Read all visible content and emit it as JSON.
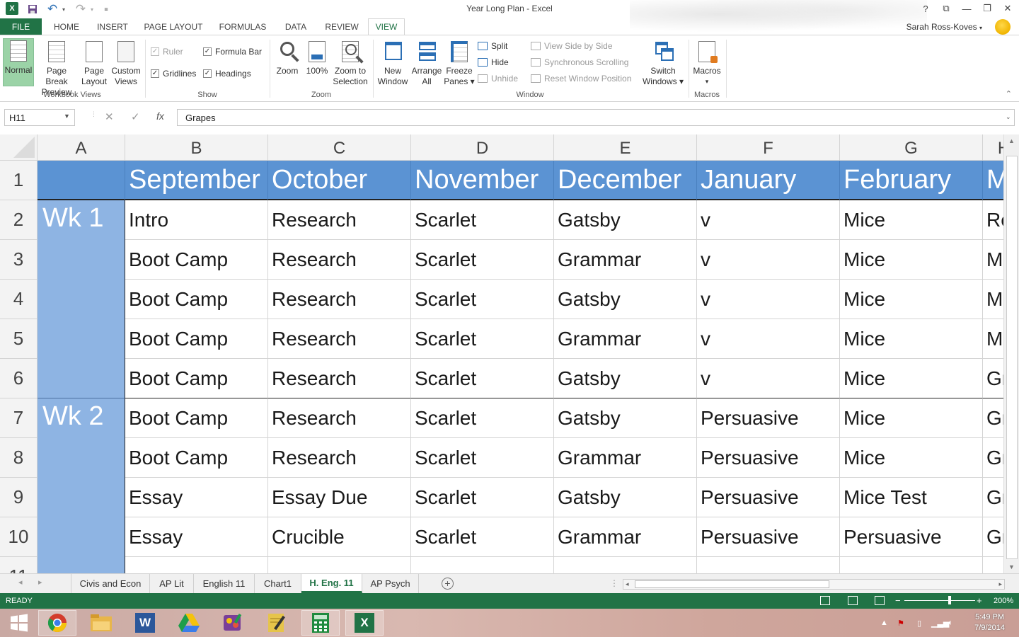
{
  "window": {
    "title": "Year Long Plan - Excel"
  },
  "qat": {
    "excel_logo": "X",
    "undo": "↶",
    "redo": "↷"
  },
  "window_controls": {
    "help": "?",
    "restore_ribbon": "⧉",
    "minimize": "—",
    "maximize": "❐",
    "close": "✕"
  },
  "tabs": [
    "FILE",
    "HOME",
    "INSERT",
    "PAGE LAYOUT",
    "FORMULAS",
    "DATA",
    "REVIEW",
    "VIEW"
  ],
  "active_tab": "VIEW",
  "user": {
    "name": "Sarah Ross-Koves"
  },
  "ribbon": {
    "workbook_views": {
      "label": "Workbook Views",
      "normal": "Normal",
      "page_break_1": "Page Break",
      "page_break_2": "Preview",
      "page_layout_1": "Page",
      "page_layout_2": "Layout",
      "custom_views_1": "Custom",
      "custom_views_2": "Views"
    },
    "show": {
      "label": "Show",
      "ruler": "Ruler",
      "formula_bar": "Formula Bar",
      "gridlines": "Gridlines",
      "headings": "Headings"
    },
    "zoom": {
      "label": "Zoom",
      "zoom": "Zoom",
      "hundred": "100%",
      "zoom_sel_1": "Zoom to",
      "zoom_sel_2": "Selection"
    },
    "window": {
      "label": "Window",
      "new_window_1": "New",
      "new_window_2": "Window",
      "arrange_1": "Arrange",
      "arrange_2": "All",
      "freeze_1": "Freeze",
      "freeze_2": "Panes ▾",
      "split": "Split",
      "hide": "Hide",
      "unhide": "Unhide",
      "side_by_side": "View Side by Side",
      "sync_scroll": "Synchronous Scrolling",
      "reset_pos": "Reset Window Position",
      "switch_1": "Switch",
      "switch_2": "Windows ▾"
    },
    "macros": {
      "label": "Macros",
      "macros": "Macros",
      "dropdown": "▾"
    }
  },
  "formula_bar": {
    "name_box": "H11",
    "cancel": "✕",
    "enter": "✓",
    "fx": "fx",
    "value": "Grapes"
  },
  "grid": {
    "columns": [
      "A",
      "B",
      "C",
      "D",
      "E",
      "F",
      "G",
      "H"
    ],
    "rows": [
      "1",
      "2",
      "3",
      "4",
      "5",
      "6",
      "7",
      "8",
      "9",
      "10",
      "11"
    ],
    "header_row": [
      "",
      "September",
      "October",
      "November",
      "December",
      "January",
      "February",
      "M"
    ],
    "week_labels": [
      "Wk 1",
      "Wk 2"
    ],
    "data": [
      [
        "Intro",
        "Research",
        "Scarlet",
        "Gatsby",
        "v",
        "Mice",
        "Re"
      ],
      [
        "Boot Camp",
        "Research",
        "Scarlet",
        "Grammar",
        "v",
        "Mice",
        "M"
      ],
      [
        "Boot Camp",
        "Research",
        "Scarlet",
        "Gatsby",
        "v",
        "Mice",
        "M"
      ],
      [
        "Boot Camp",
        "Research",
        "Scarlet",
        "Grammar",
        "v",
        "Mice",
        "M"
      ],
      [
        "Boot Camp",
        "Research",
        "Scarlet",
        "Gatsby",
        "v",
        "Mice",
        "Gr"
      ],
      [
        "Boot Camp",
        "Research",
        "Scarlet",
        "Gatsby",
        "Persuasive",
        "Mice",
        "Gr"
      ],
      [
        "Boot Camp",
        "Research",
        "Scarlet",
        "Grammar",
        "Persuasive",
        "Mice",
        "Gr"
      ],
      [
        "Essay",
        "Essay Due",
        "Scarlet",
        "Gatsby",
        "Persuasive",
        "Mice Test",
        "Gr"
      ],
      [
        "Essay",
        "Crucible",
        "Scarlet",
        "Grammar",
        "Persuasive",
        "Persuasive",
        "Gr"
      ],
      [
        "",
        "",
        "",
        "",
        "",
        "",
        ""
      ]
    ]
  },
  "sheet_tabs": [
    "Civis and Econ",
    "AP Lit",
    "English 11",
    "Chart1",
    "H. Eng. 11",
    "AP Psych"
  ],
  "active_sheet": "H. Eng. 11",
  "add_sheet": "+",
  "status": {
    "text": "READY",
    "zoom": "200%",
    "minus": "−",
    "plus": "+"
  },
  "taskbar": {
    "apps": [
      "windows-start",
      "chrome",
      "file-explorer",
      "word",
      "google-drive",
      "paint",
      "notes",
      "calculator",
      "excel"
    ],
    "word_letter": "W",
    "excel_letter": "X",
    "time": "5:49 PM",
    "date": "7/9/2014"
  }
}
